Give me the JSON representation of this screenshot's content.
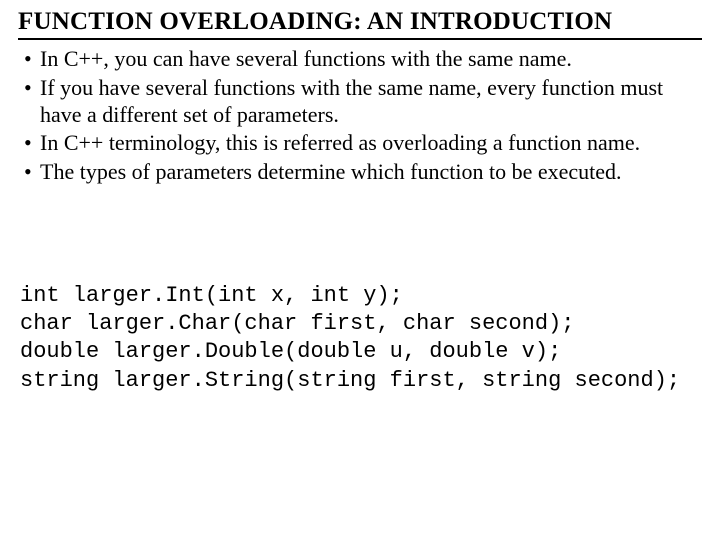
{
  "title": "FUNCTION OVERLOADING: AN INTRODUCTION",
  "bullets": [
    "In C++, you can have several functions with the same name.",
    "If you have several functions with the same name, every function must have a different set of parameters.",
    "In C++ terminology, this is referred as overloading a function name.",
    "The types of parameters determine which function to be executed."
  ],
  "code": [
    "int larger.Int(int x, int y);",
    "char larger.Char(char first, char second);",
    "double larger.Double(double u, double v);",
    "string larger.String(string first, string second);"
  ]
}
